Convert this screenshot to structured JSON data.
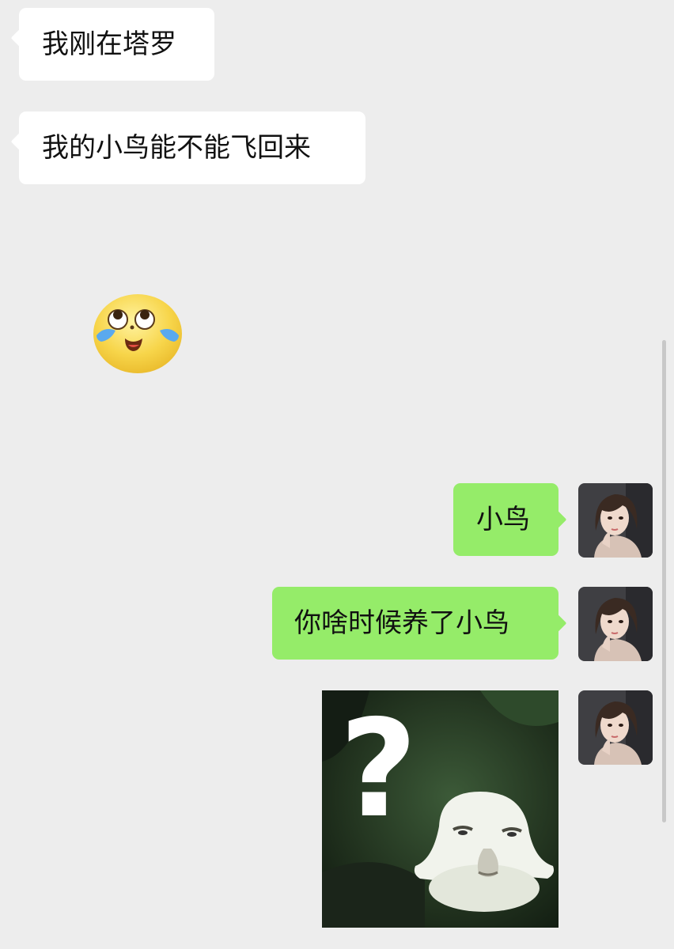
{
  "messages": {
    "incoming_1": "我刚在塔罗",
    "incoming_2": "我的小鸟能不能飞回来",
    "incoming_emoji": "crying-laughing-emoji",
    "outgoing_1": "小鸟",
    "outgoing_2": "你啥时候养了小鸟",
    "outgoing_sticker": "question-mark-blob-sticker"
  },
  "sticker": {
    "question_mark": "?"
  },
  "colors": {
    "background": "#ededed",
    "incoming_bubble": "#ffffff",
    "outgoing_bubble": "#95ec69",
    "text": "#111111"
  }
}
